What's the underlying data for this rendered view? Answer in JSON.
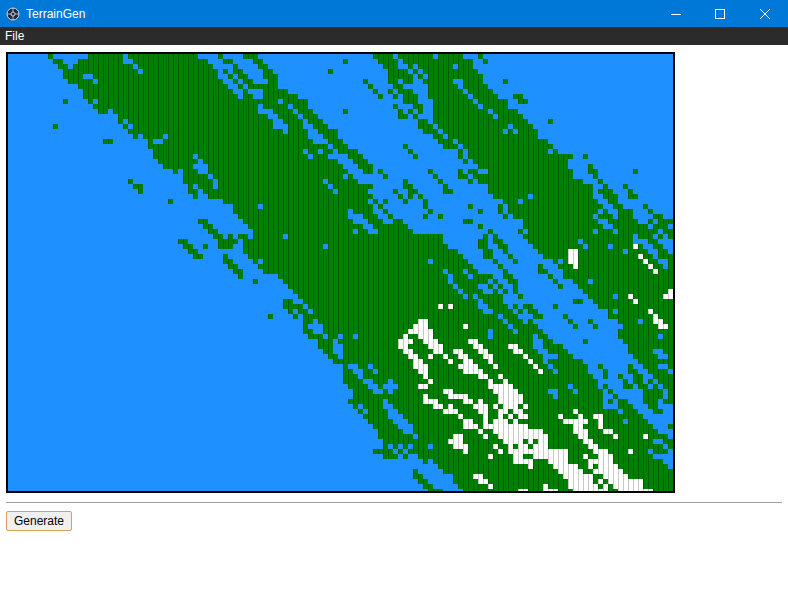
{
  "window": {
    "title": "TerrainGen"
  },
  "menu": [
    "File"
  ],
  "buttons": [
    "Generate"
  ]
}
